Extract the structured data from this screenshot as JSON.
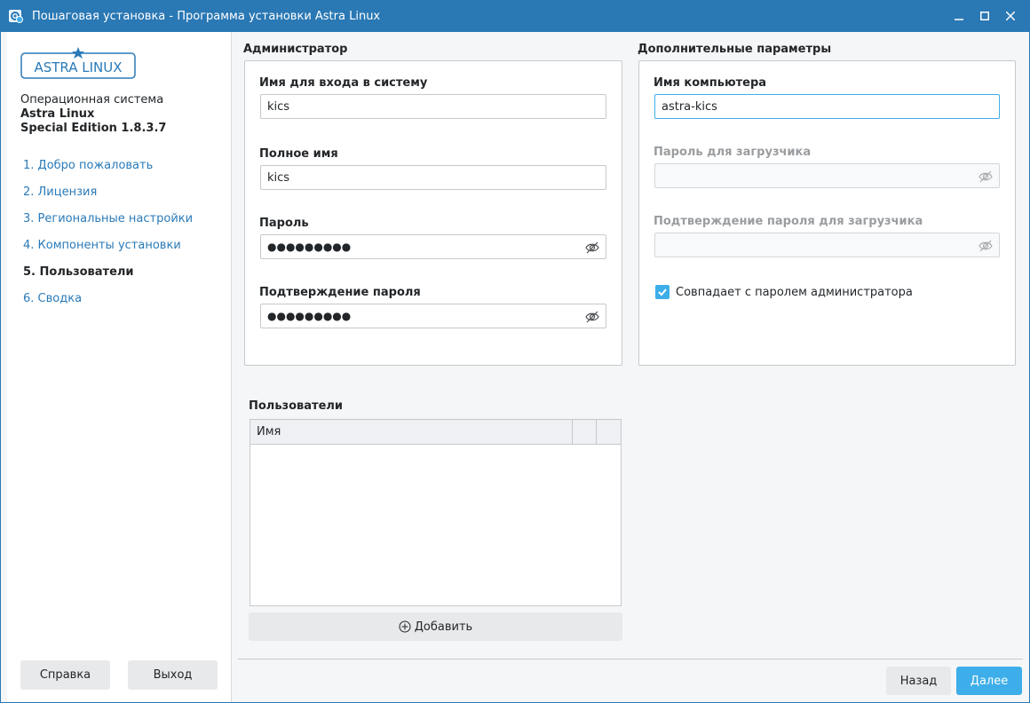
{
  "window": {
    "title": "Пошаговая установка - Программа установки Astra Linux",
    "minimize_icon": "minimize-icon",
    "maximize_icon": "maximize-icon",
    "close_icon": "close-icon"
  },
  "sidebar": {
    "logo_text": "ASTRA LINUX",
    "os_line1": "Операционная система",
    "os_line2": "Astra Linux",
    "os_line3": "Special Edition 1.8.3.7",
    "steps": [
      {
        "label": "1. Добро пожаловать"
      },
      {
        "label": "2. Лицензия"
      },
      {
        "label": "3. Региональные настройки"
      },
      {
        "label": "4. Компоненты установки"
      },
      {
        "label": "5. Пользователи"
      },
      {
        "label": "6. Сводка"
      }
    ],
    "active_step": 4,
    "help_label": "Справка",
    "exit_label": "Выход"
  },
  "admin": {
    "group_title": "Администратор",
    "login_label": "Имя для входа в систему",
    "login_value": "kics",
    "fullname_label": "Полное имя",
    "fullname_value": "kics",
    "password_label": "Пароль",
    "password_value": "●●●●●●●●●",
    "confirm_label": "Подтверждение пароля",
    "confirm_value": "●●●●●●●●●"
  },
  "extra": {
    "group_title": "Дополнительные параметры",
    "hostname_label": "Имя компьютера",
    "hostname_value": "astra-kics",
    "bootloader_pw_label": "Пароль для загрузчика",
    "bootloader_confirm_label": "Подтверждение пароля для загрузчика",
    "same_as_admin_label": "Совпадает с паролем администратора",
    "same_as_admin_checked": true
  },
  "users": {
    "group_title": "Пользователи",
    "columns": [
      "Имя",
      "",
      ""
    ],
    "rows": [],
    "add_label": "Добавить"
  },
  "footer": {
    "back_label": "Назад",
    "next_label": "Далее"
  },
  "colors": {
    "titlebar": "#2a78b4",
    "accent": "#3daee9",
    "link": "#2a7ab8"
  }
}
